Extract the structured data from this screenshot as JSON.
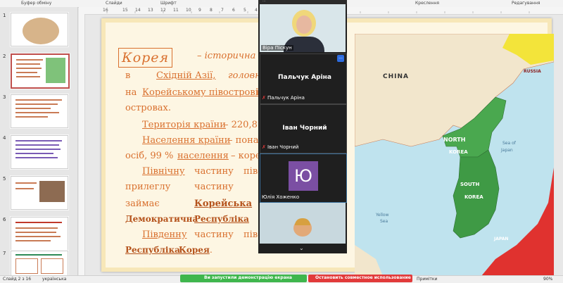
{
  "ribbon": {
    "groups": [
      "Буфер обміну",
      "Слайди",
      "Шрифт",
      "Креслення",
      "Редагування"
    ]
  },
  "ruler": {
    "ticks": [
      "16",
      "15",
      "14",
      "13",
      "12",
      "11",
      "10",
      "9",
      "8",
      "7",
      "6",
      "5",
      "4",
      "3",
      "2",
      "1",
      "0",
      "1",
      "2",
      "3",
      "4",
      "5",
      "6",
      "7",
      "8",
      "9",
      "10",
      "11",
      "12",
      "13",
      "14",
      "15",
      "16"
    ]
  },
  "slides": {
    "numbers": [
      "1",
      "2",
      "3",
      "4",
      "5",
      "6",
      "7"
    ]
  },
  "slide": {
    "line1_a": "Корея",
    "line1_b": "– історична",
    "line2_a": "в",
    "line2_b": "Східній Азії,",
    "line2_c": "головним",
    "line3_a": "на",
    "line3_b": "Корейському півострові",
    "line3_c": "і",
    "line4": "островах.",
    "line5_a": "Територія країни",
    "line5_b": "– 220,8 т",
    "line6_a": "Населення країни",
    "line6_b": "– понад",
    "line7_a": "осіб, 99 %",
    "line7_b": "населення",
    "line7_c": "– корейці.",
    "line8_a": "Північну",
    "line8_b": "частину",
    "line8_c": "півос",
    "line9_a": "прилеглу",
    "line9_b": "частину",
    "line10_a": "займає",
    "line10_b": "Корейська",
    "line11_a": "Демократична",
    "line11_b": "Республіка",
    "line12_a": "Південну",
    "line12_b": "частину",
    "line12_c": "півос",
    "line13_a": "Республіка",
    "line13_b": "Корея",
    "line13_c": "."
  },
  "map": {
    "labels": {
      "china": "CHINA",
      "russia": "RUSSIA",
      "north": "NORTH",
      "korea_n": "KOREA",
      "south": "SOUTH",
      "korea_s": "KOREA",
      "sea_japan_1": "Sea of",
      "sea_japan_2": "Japan",
      "yellow_1": "Yellow",
      "yellow_2": "Sea",
      "japan": "JAPAN"
    }
  },
  "video": {
    "participant1": "Віра Піскун",
    "participant2_big": "Пальчук Аріна",
    "participant2": "Пальчук Аріна",
    "participant3_big": "Іван Чорний",
    "participant3": "Іван Чорний",
    "participant4_initial": "Ю",
    "participant4": "Юлія Хоженко",
    "more_icon": "..."
  },
  "status": {
    "slide": "Слайд 2 з 16",
    "lang": "українська",
    "notes": "Примітки",
    "zoom": "90%"
  },
  "share": {
    "running": "Ви запустили демонстрацію екрана",
    "stop": "Остановить совместное использование"
  },
  "colors": {
    "slide_text": "#d9702e",
    "accent_red": "#c0504d",
    "north_korea": "#4aa84f",
    "japan_red": "#e0322f",
    "russia_yellow": "#f3e43a",
    "share_green": "#3fb64d",
    "stop_red": "#e23a3a"
  }
}
